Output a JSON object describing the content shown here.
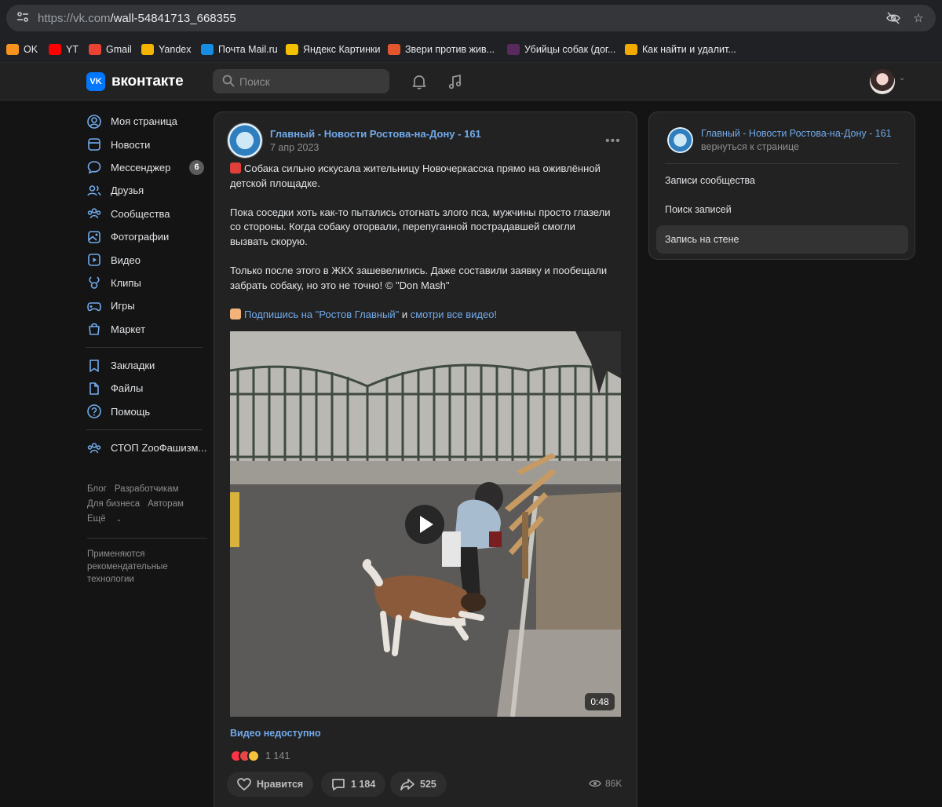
{
  "browser": {
    "url_host": "https://vk.com",
    "url_path": "/wall-54841713_668355",
    "bookmarks": [
      {
        "label": "OK",
        "color": "#f7931e"
      },
      {
        "label": "YT",
        "color": "#ff0000"
      },
      {
        "label": "Gmail",
        "color": "#ea4335"
      },
      {
        "label": "Yandex",
        "color": "#f4b400"
      },
      {
        "label": "Почта Mail.ru",
        "color": "#168de2"
      },
      {
        "label": "Яндекс Картинки",
        "color": "#f4c000"
      },
      {
        "label": "Звери против жив...",
        "color": "#e4572e"
      },
      {
        "label": "Убийцы собак (дог...",
        "color": "#5a2a5e"
      },
      {
        "label": "Как найти и удалит...",
        "color": "#f2a900"
      }
    ]
  },
  "header": {
    "logo_text": "вконтакте",
    "search_placeholder": "Поиск"
  },
  "nav": {
    "items": [
      {
        "label": "Моя страница",
        "icon": "user-circle-icon"
      },
      {
        "label": "Новости",
        "icon": "news-icon"
      },
      {
        "label": "Мессенджер",
        "icon": "message-icon",
        "badge": "6"
      },
      {
        "label": "Друзья",
        "icon": "friends-icon"
      },
      {
        "label": "Сообщества",
        "icon": "groups-icon"
      },
      {
        "label": "Фотографии",
        "icon": "photos-icon"
      },
      {
        "label": "Видео",
        "icon": "video-icon"
      },
      {
        "label": "Клипы",
        "icon": "clips-icon"
      },
      {
        "label": "Игры",
        "icon": "games-icon"
      },
      {
        "label": "Маркет",
        "icon": "market-icon"
      }
    ],
    "items2": [
      {
        "label": "Закладки",
        "icon": "bookmark-icon"
      },
      {
        "label": "Файлы",
        "icon": "file-icon"
      },
      {
        "label": "Помощь",
        "icon": "help-icon"
      }
    ],
    "items3": [
      {
        "label": "СТОП ZooФашизм...",
        "icon": "groups-icon"
      }
    ],
    "footer": {
      "blog": "Блог",
      "developers": "Разработчикам",
      "business": "Для бизнеса",
      "authors": "Авторам",
      "more": "Ещё"
    },
    "reco": "Применяются рекомендательные технологии"
  },
  "post": {
    "author": "Главный - Новости Ростова-на-Дону - 161",
    "date": "7 апр 2023",
    "text1": "Собака сильно искусала жительницу Новочеркасска прямо на оживлённой детской площадке.",
    "text2": "Пока соседки хоть как-то пытались отогнать злого пса, мужчины просто глазели со стороны. Когда собаку оторвали, перепуганной пострадавшей смогли вызвать скорую.",
    "text3": "Только после этого в ЖКХ зашевелились. Даже составили заявку и пообещали забрать собаку, но это не точно! © \"Don Mash\"",
    "subscribe_link": "Подпишись на \"Ростов Главный\"",
    "and": "и",
    "watch_link": "смотри все видео!",
    "video_duration": "0:48",
    "video_status": "Видео недоступно",
    "reactions_count": "1 141",
    "like_label": "Нравится",
    "comments_count": "1 184",
    "shares_count": "525",
    "views": "86K"
  },
  "right_panel": {
    "community": "Главный - Новости Ростова-на-Дону - 161",
    "back": "вернуться к странице",
    "items": [
      "Записи сообщества",
      "Поиск записей",
      "Запись на стене"
    ],
    "active_index": 2
  },
  "colors": {
    "accent": "#71aaeb",
    "brand": "#0077ff",
    "background": "#141414",
    "card": "#222222"
  }
}
